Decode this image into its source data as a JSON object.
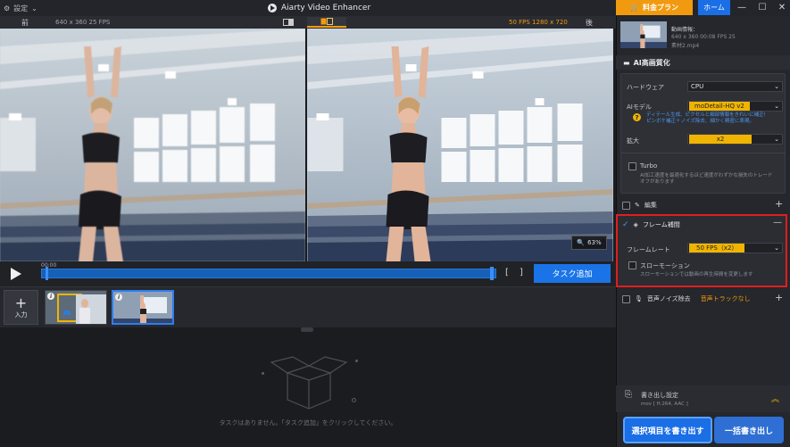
{
  "titlebar": {
    "settings_label": "設定",
    "app_title": "Aiarty Video Enhancer",
    "plan_label": "料金プラン",
    "home_label": "ホーム"
  },
  "compare": {
    "before_label": "前",
    "before_info": "640 x 360  25 FPS",
    "after_info": "50 FPS   1280 x 720",
    "after_label": "後",
    "zoom": "63%"
  },
  "playback": {
    "time": "00:00",
    "bracket_in": "[",
    "bracket_out": "]",
    "add_task": "タスク追加"
  },
  "thumbnails": {
    "import_label": "入力"
  },
  "taskarea": {
    "empty_message": "タスクはありません。「タスク追加」をクリックしてください。"
  },
  "file": {
    "title": "動画情報：",
    "specs": "640 x 360  00:08  FPS 25",
    "name": "素材2.mp4"
  },
  "ai": {
    "section_title": "AI高画質化",
    "hardware_label": "ハードウェア",
    "hardware_value": "CPU",
    "model_label": "AIモデル",
    "model_value": "moDetail-HQ  v2",
    "model_hint_1": "ディテール生成、ピクセルと細部情報をきれいに補正!",
    "model_hint_2": "ピンボケ補正＋ノイズ除去、細かく精密に表現。",
    "scale_label": "拡大",
    "scale_value": "x2",
    "turbo_label": "Turbo",
    "turbo_hint_1": "AI加工速度を最適化するほど速度がわずかな損失のトレード",
    "turbo_hint_2": "オフがあります"
  },
  "edit": {
    "label": "編集"
  },
  "interp": {
    "label": "フレーム補間",
    "rate_label": "フレームレート",
    "rate_value": "50 FPS（x2）",
    "slowmo_label": "スローモーション",
    "slowmo_hint": "スローモーションでは動画の再生時間を変更します"
  },
  "audio": {
    "label": "音声ノイズ除去",
    "value": "音声トラックなし"
  },
  "export": {
    "title": "書き出し設定",
    "format": "mov [ H.264, AAC ]",
    "btn_selected": "選択項目を書き出す",
    "btn_all": "一括書き出し"
  },
  "colors": {
    "accent_orange": "#f29a0f",
    "accent_blue": "#1a6ee6",
    "highlight_red": "#e01e1e",
    "select_yellow": "#f0b400"
  }
}
